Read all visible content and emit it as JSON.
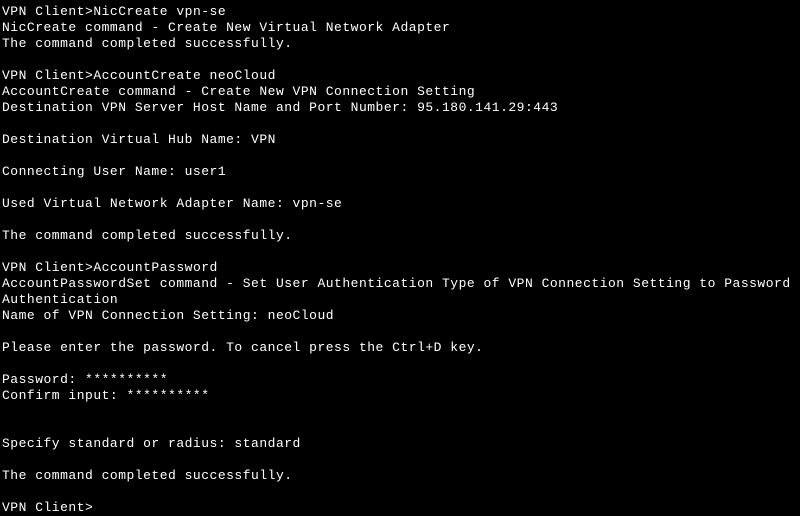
{
  "terminal": {
    "prompt": "VPN Client>",
    "entries": [
      {
        "type": "prompt_cmd",
        "cmd": "NicCreate vpn-se"
      },
      {
        "type": "output",
        "text": "NicCreate command - Create New Virtual Network Adapter"
      },
      {
        "type": "output",
        "text": "The command completed successfully."
      },
      {
        "type": "blank"
      },
      {
        "type": "prompt_cmd",
        "cmd": "AccountCreate neoCloud"
      },
      {
        "type": "output",
        "text": "AccountCreate command - Create New VPN Connection Setting"
      },
      {
        "type": "output",
        "text": "Destination VPN Server Host Name and Port Number: 95.180.141.29:443"
      },
      {
        "type": "blank"
      },
      {
        "type": "output",
        "text": "Destination Virtual Hub Name: VPN"
      },
      {
        "type": "blank"
      },
      {
        "type": "output",
        "text": "Connecting User Name: user1"
      },
      {
        "type": "blank"
      },
      {
        "type": "output",
        "text": "Used Virtual Network Adapter Name: vpn-se"
      },
      {
        "type": "blank"
      },
      {
        "type": "output",
        "text": "The command completed successfully."
      },
      {
        "type": "blank"
      },
      {
        "type": "prompt_cmd",
        "cmd": "AccountPassword"
      },
      {
        "type": "output",
        "text": "AccountPasswordSet command - Set User Authentication Type of VPN Connection Setting to Password Authentication"
      },
      {
        "type": "output",
        "text": "Name of VPN Connection Setting: neoCloud"
      },
      {
        "type": "blank"
      },
      {
        "type": "output",
        "text": "Please enter the password. To cancel press the Ctrl+D key."
      },
      {
        "type": "blank"
      },
      {
        "type": "output",
        "text": "Password: **********"
      },
      {
        "type": "output",
        "text": "Confirm input: **********"
      },
      {
        "type": "blank"
      },
      {
        "type": "blank"
      },
      {
        "type": "output",
        "text": "Specify standard or radius: standard"
      },
      {
        "type": "blank"
      },
      {
        "type": "output",
        "text": "The command completed successfully."
      },
      {
        "type": "blank"
      },
      {
        "type": "prompt_cmd",
        "cmd": ""
      }
    ]
  }
}
